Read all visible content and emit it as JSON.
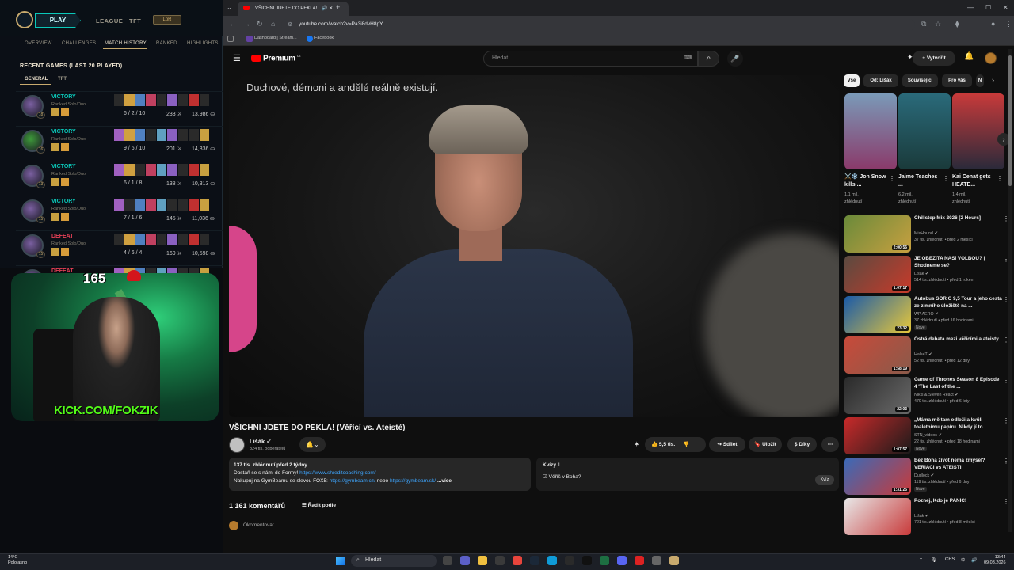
{
  "lol": {
    "play": "PLAY",
    "nav": [
      "LEAGUE",
      "TFT"
    ],
    "badge": "LoR",
    "subnav": [
      "OVERVIEW",
      "CHALLENGES",
      "MATCH HISTORY",
      "RANKED",
      "HIGHLIGHTS"
    ],
    "heading": "RECENT GAMES (LAST 20 PLAYED)",
    "tabs": [
      "GENERAL",
      "TFT"
    ],
    "games": [
      {
        "result": "VICTORY",
        "mode": "Ranked Solo/Duo",
        "level": "18",
        "kda": "6 / 2 / 10",
        "cs": "233",
        "gold": "13,986",
        "avatar": "#7a5fa0"
      },
      {
        "result": "VICTORY",
        "mode": "Ranked Solo/Duo",
        "level": "16",
        "kda": "9 / 6 / 10",
        "cs": "201",
        "gold": "14,336",
        "avatar": "#3e9a3a"
      },
      {
        "result": "VICTORY",
        "mode": "Ranked Solo/Duo",
        "level": "13",
        "kda": "6 / 1 / 8",
        "cs": "138",
        "gold": "10,313",
        "avatar": "#7a5fa0"
      },
      {
        "result": "VICTORY",
        "mode": "Ranked Solo/Duo",
        "level": "15",
        "kda": "7 / 1 / 6",
        "cs": "145",
        "gold": "11,036",
        "avatar": "#7a5fa0"
      },
      {
        "result": "DEFEAT",
        "mode": "Ranked Solo/Duo",
        "level": "15",
        "kda": "4 / 6 / 4",
        "cs": "169",
        "gold": "10,598",
        "avatar": "#7a5fa0"
      },
      {
        "result": "DEFEAT",
        "mode": "",
        "level": "",
        "kda": "",
        "cs": "",
        "gold": "",
        "avatar": "#7a5fa0"
      }
    ]
  },
  "stream": {
    "counter": "165",
    "kick": "KICK.COM/FOKZIK"
  },
  "browser": {
    "tab_title": "VŠICHNI JDETE DO PEKLA!",
    "url": "youtube.com/watch?v=Pa3i8dvH8pY",
    "bookmarks": [
      "Dashboard | Stream...",
      "Facebook"
    ]
  },
  "yt": {
    "logo": "Premium",
    "logo_sup": "CZ",
    "search_placeholder": "Hledat",
    "create": "Vytvořit",
    "overlay_title": "Duchové, démoni a andělé reálně existují.",
    "video_title": "VŠICHNI JDETE DO PEKLA! (Věřící vs. Ateisté)",
    "channel": "Lišák",
    "subs": "324 tis. odběratelů",
    "likes": "5,5 tis.",
    "share": "Sdílet",
    "save": "Uložit",
    "thanks": "Díky",
    "desc": {
      "meta": "137 tis. zhlédnutí  před 2 týdny",
      "line1": "Dostaň se s námi do Formy!",
      "link1": "https://www.shreditcoaching.com/",
      "line2": "Nakupuj na GymBeamu se slevou FOX5:",
      "link2": "https://gymbeam.cz/",
      "or": "nebo",
      "link3": "https://gymbeam.sk/",
      "more": "...více"
    },
    "quiz": {
      "label": "Kvízy",
      "count": "1",
      "question": "Věříš v Boha?",
      "button": "Kvíz"
    },
    "comments": "1 161 komentářů",
    "sort": "Řadit podle",
    "comment_placeholder": "Okomentovat...",
    "chips": [
      "Vše",
      "Od: Lišák",
      "Související",
      "Pro vás",
      "N"
    ],
    "shorts": [
      {
        "title": "⚔️❄️ Jon Snow kills ...",
        "views": "1,1 mil. zhlédnutí",
        "c1": "#7a9ab8",
        "c2": "#8a3a6a"
      },
      {
        "title": "Jaime Teaches ...",
        "views": "6,2 mil. zhlédnutí",
        "c1": "#2a6a7a",
        "c2": "#1a3a3a"
      },
      {
        "title": "Kai Cenat gets HEATE...",
        "views": "1,4 mil. zhlédnutí",
        "c1": "#c83a3a",
        "c2": "#2a2a3a"
      }
    ],
    "recs": [
      {
        "title": "Chillstep Mix 2026 [2 Hours]",
        "channel": "MixHound",
        "meta": "37 tis. zhlédnutí • před 2 měsíci",
        "dur": "2:00:56",
        "new": "",
        "c1": "#6a8a3a",
        "c2": "#c8a040"
      },
      {
        "title": "JE OBEZITA NAŠÍ VOLBOU? | Shodneme se?",
        "channel": "Lišák",
        "meta": "514 tis. zhlédnutí • před 1 rokem",
        "dur": "1:07:17",
        "new": "",
        "c1": "#5a4a40",
        "c2": "#c83a2a"
      },
      {
        "title": "Autobus SOR C 9,5 Tour a jeho cesta ze zimního úložiště na ...",
        "channel": "WP AERO",
        "meta": "37 zhlédnutí • před 16 hodinami",
        "dur": "23:32",
        "new": "Nové",
        "c1": "#1a5aa8",
        "c2": "#e8c83a"
      },
      {
        "title": "Ostrá debata mezi věřícími a ateisty",
        "channel": "HalseT",
        "meta": "52 tis. zhlédnutí • před 12 dny",
        "dur": "1:58:19",
        "new": "",
        "c1": "#c84a3a",
        "c2": "#8a5a4a"
      },
      {
        "title": "Game of Thrones Season 8 Episode 4 'The Last of the ...",
        "channel": "Nikki & Steven React",
        "meta": "479 tis. zhlédnutí • před 6 lety",
        "dur": "22:03",
        "new": "",
        "c1": "#2a2a2a",
        "c2": "#6a6a6a"
      },
      {
        "title": "„Máma mě tam odložila kvůli toaletnímu papíru. Nikdy jí to ...",
        "channel": "STN_videos",
        "meta": "22 tis. zhlédnutí • před 18 hodinami",
        "dur": "1:07:57",
        "new": "Nové",
        "c1": "#c82a2a",
        "c2": "#1a1a1a"
      },
      {
        "title": "Bez Boha život nemá zmysel? VERIACI vs ATEISTI",
        "channel": "Dudlock",
        "meta": "119 tis. zhlédnutí • před 6 dny",
        "dur": "1:31:25",
        "new": "Nové",
        "c1": "#3a6ab8",
        "c2": "#c83a3a"
      },
      {
        "title": "Poznej, Kdo je PANIC!",
        "channel": "Lišák",
        "meta": "721 tis. zhlédnutí • před 8 měsíci",
        "dur": "",
        "new": "",
        "c1": "#e8e8e8",
        "c2": "#c83a3a"
      }
    ]
  },
  "taskbar": {
    "temp": "14°C",
    "weather": "Polojasno",
    "search": "Hledat",
    "lang": "CES",
    "time": "13:44",
    "date": "09.03.2026"
  }
}
